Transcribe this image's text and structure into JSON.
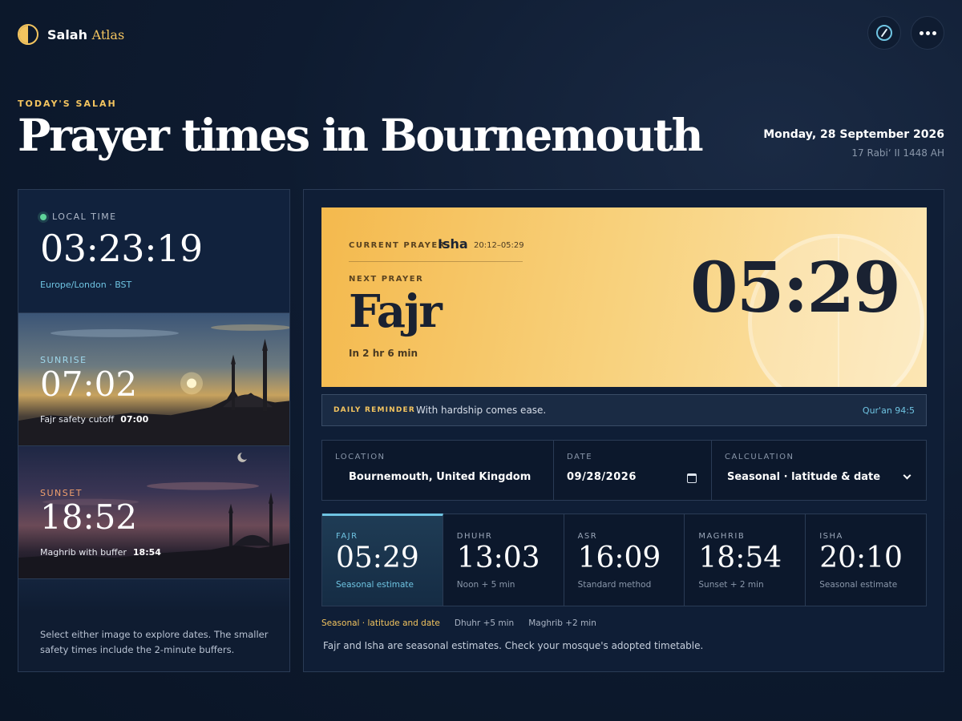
{
  "brand": {
    "name": "Salah",
    "accent": "Atlas"
  },
  "header": {
    "eyebrow": "TODAY'S SALAH",
    "title": "Prayer times in Bournemouth",
    "date": "Monday, 28 September 2026",
    "hijri": "17 Rabiʻ II 1448 AH"
  },
  "icons": {
    "compass": "compass-icon",
    "more": "more-icon"
  },
  "local": {
    "label": "LOCAL TIME",
    "time": "03:23:19",
    "timezone": "Europe/London · BST"
  },
  "sunrise": {
    "label": "SUNRISE",
    "time": "07:02",
    "note": "Fajr safety cutoff",
    "note_value": "07:00"
  },
  "sunset": {
    "label": "SUNSET",
    "time": "18:52",
    "note": "Maghrib with buffer",
    "note_value": "18:54"
  },
  "left_footer": "Select either image to explore dates. The smaller safety times include the 2-minute buffers.",
  "hero": {
    "current_label": "CURRENT PRAYER",
    "current_name": "Isha",
    "current_range": "20:12–05:29",
    "next_label": "NEXT PRAYER",
    "next_name": "Fajr",
    "next_in": "In 2 hr 6 min",
    "next_time": "05:29"
  },
  "reminder": {
    "label": "DAILY REMINDER",
    "text": "With hardship comes ease.",
    "ref": "Qur'an 94:5"
  },
  "controls": {
    "location_label": "LOCATION",
    "location_value": "Bournemouth, United Kingdom",
    "date_label": "DATE",
    "date_value": "09/28/2026",
    "calc_label": "CALCULATION",
    "calc_value": "Seasonal · latitude & date"
  },
  "prayers": [
    {
      "label": "FAJR",
      "time": "05:29",
      "note": "Seasonal estimate"
    },
    {
      "label": "DHUHR",
      "time": "13:03",
      "note": "Noon + 5 min"
    },
    {
      "label": "ASR",
      "time": "16:09",
      "note": "Standard method"
    },
    {
      "label": "MAGHRIB",
      "time": "18:54",
      "note": "Sunset + 2 min"
    },
    {
      "label": "ISHA",
      "time": "20:10",
      "note": "Seasonal estimate"
    }
  ],
  "chips": [
    "Seasonal · latitude and date",
    "Dhuhr +5 min",
    "Maghrib +2 min"
  ],
  "disclaimer": "Fajr and Isha are seasonal estimates. Check your mosque's adopted timetable.",
  "colors": {
    "accent_gold": "#f3c45f",
    "accent_cyan": "#6fc4e2",
    "live": "#5fd49a",
    "background": "#0e1b30"
  }
}
